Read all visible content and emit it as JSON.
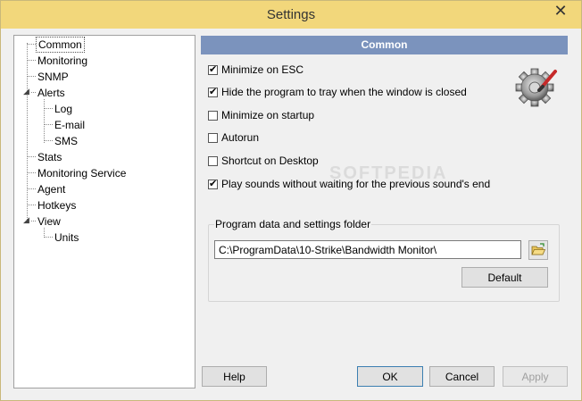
{
  "window": {
    "title": "Settings"
  },
  "tree": {
    "items": [
      {
        "label": "Common",
        "selected": true
      },
      {
        "label": "Monitoring"
      },
      {
        "label": "SNMP"
      },
      {
        "label": "Alerts"
      },
      {
        "label": "Log"
      },
      {
        "label": "E-mail"
      },
      {
        "label": "SMS"
      },
      {
        "label": "Stats"
      },
      {
        "label": "Monitoring Service"
      },
      {
        "label": "Agent"
      },
      {
        "label": "Hotkeys"
      },
      {
        "label": "View"
      },
      {
        "label": "Units"
      }
    ]
  },
  "panel": {
    "header": "Common",
    "checkboxes": [
      {
        "label": "Minimize on ESC",
        "checked": true
      },
      {
        "label": "Hide the program to tray when the window is closed",
        "checked": true
      },
      {
        "label": "Minimize on startup",
        "checked": false
      },
      {
        "label": "Autorun",
        "checked": false
      },
      {
        "label": "Shortcut on Desktop",
        "checked": false
      },
      {
        "label": "Play sounds without waiting for the previous sound's end",
        "checked": true
      }
    ],
    "watermark": "SOFTPEDIA",
    "folder_group": {
      "label": "Program data and settings folder",
      "path": "C:\\ProgramData\\10-Strike\\Bandwidth Monitor\\",
      "default_label": "Default"
    }
  },
  "footer": {
    "help_label": "Help",
    "ok_label": "OK",
    "cancel_label": "Cancel",
    "apply_label": "Apply"
  },
  "colors": {
    "titlebar": "#f2d77b",
    "panel_header": "#7b93bd",
    "focus_border": "#3c7fb1"
  }
}
